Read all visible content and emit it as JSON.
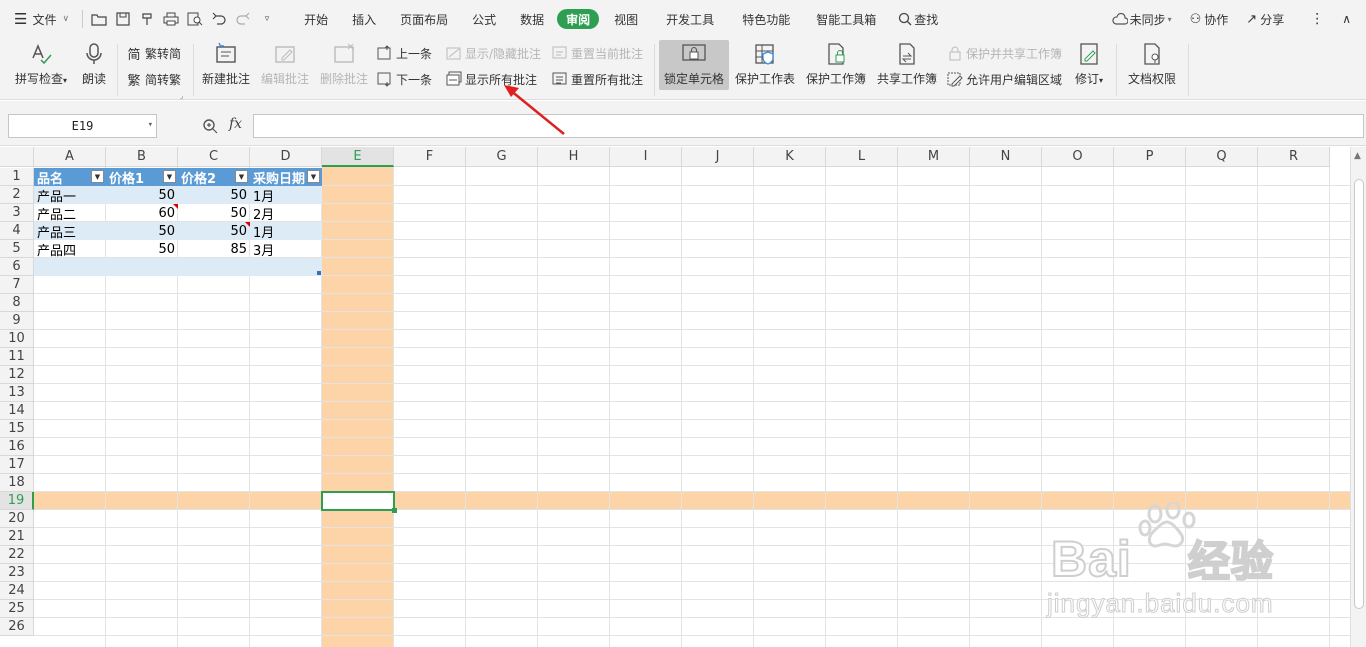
{
  "menubar": {
    "file_label": "文件",
    "tabs": [
      "开始",
      "插入",
      "页面布局",
      "公式",
      "数据",
      "审阅",
      "视图",
      "开发工具",
      "特色功能",
      "智能工具箱"
    ],
    "active_tab": "审阅",
    "search_label": "查找",
    "sync_label": "未同步",
    "collab_label": "协作",
    "share_label": "分享"
  },
  "ribbon": {
    "spell_check": "拼写检查",
    "read_aloud": "朗读",
    "trad_to_simp": "繁转简",
    "simp_to_trad": "简转繁",
    "new_comment": "新建批注",
    "edit_comment": "编辑批注",
    "delete_comment": "删除批注",
    "prev_comment": "上一条",
    "next_comment": "下一条",
    "show_hide_comment": "显示/隐藏批注",
    "show_all_comments": "显示所有批注",
    "reset_current_comment": "重置当前批注",
    "reset_all_comments": "重置所有批注",
    "lock_cells": "锁定单元格",
    "protect_sheet": "保护工作表",
    "protect_workbook": "保护工作簿",
    "share_workbook": "共享工作簿",
    "protect_shared_workbook": "保护并共享工作簿",
    "allow_edit_ranges": "允许用户编辑区域",
    "track_changes": "修订",
    "doc_permissions": "文档权限"
  },
  "formula_bar": {
    "name_box": "E19",
    "fx_label": "fx",
    "formula": ""
  },
  "sheet": {
    "columns": [
      "A",
      "B",
      "C",
      "D",
      "E",
      "F",
      "G",
      "H",
      "I",
      "J",
      "K",
      "L",
      "M",
      "N",
      "O",
      "P",
      "Q",
      "R"
    ],
    "rows": [
      "1",
      "2",
      "3",
      "4",
      "5",
      "6",
      "7",
      "8",
      "9",
      "10",
      "11",
      "12",
      "13",
      "14",
      "15",
      "16",
      "17",
      "18",
      "19",
      "20",
      "21",
      "22",
      "23",
      "24",
      "25",
      "26"
    ],
    "selected_column": "E",
    "selected_row": "19",
    "table_headers": [
      "品名",
      "价格1",
      "价格2",
      "采购日期"
    ],
    "table_rows": [
      [
        "产品一",
        "50",
        "50",
        "1月"
      ],
      [
        "产品二",
        "60",
        "50",
        "2月"
      ],
      [
        "产品三",
        "50",
        "50",
        "1月"
      ],
      [
        "产品四",
        "50",
        "85",
        "3月"
      ]
    ]
  },
  "colors": {
    "accent": "#2e9e53",
    "highlight": "#fcd4a7",
    "table_header": "#5b9bd5",
    "table_band": "#ddebf7",
    "annotation_arrow": "#e02020"
  },
  "watermark": {
    "brand": "Bai",
    "brand_suffix": "经验",
    "url": "jingyan.baidu.com"
  }
}
